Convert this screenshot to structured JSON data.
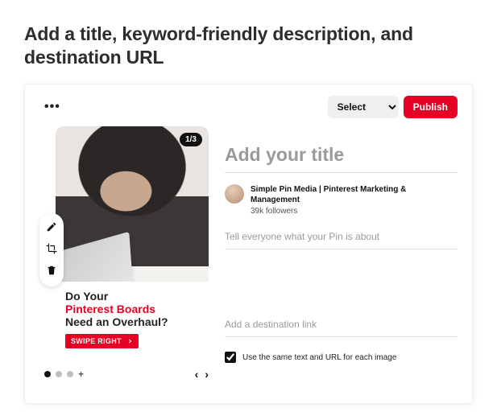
{
  "heading": "Add a title, keyword-friendly description, and destination URL",
  "topbar": {
    "board_select_label": "Select",
    "publish_label": "Publish"
  },
  "preview": {
    "counter": "1/3",
    "caption": {
      "line1": "Do Your",
      "line2_red": "Pinterest Boards",
      "line3": "Need an Overhaul?",
      "swipe": "SWIPE RIGHT"
    }
  },
  "pager": {
    "active_index": 0,
    "total": 3
  },
  "form": {
    "title_placeholder": "Add your title",
    "author_name": "Simple Pin Media | Pinterest Marketing & Management",
    "author_followers": "39k followers",
    "desc_placeholder": "Tell everyone what your Pin is about",
    "link_placeholder": "Add a destination link",
    "same_text_label": "Use the same text and URL for each image",
    "same_text_checked": true
  }
}
